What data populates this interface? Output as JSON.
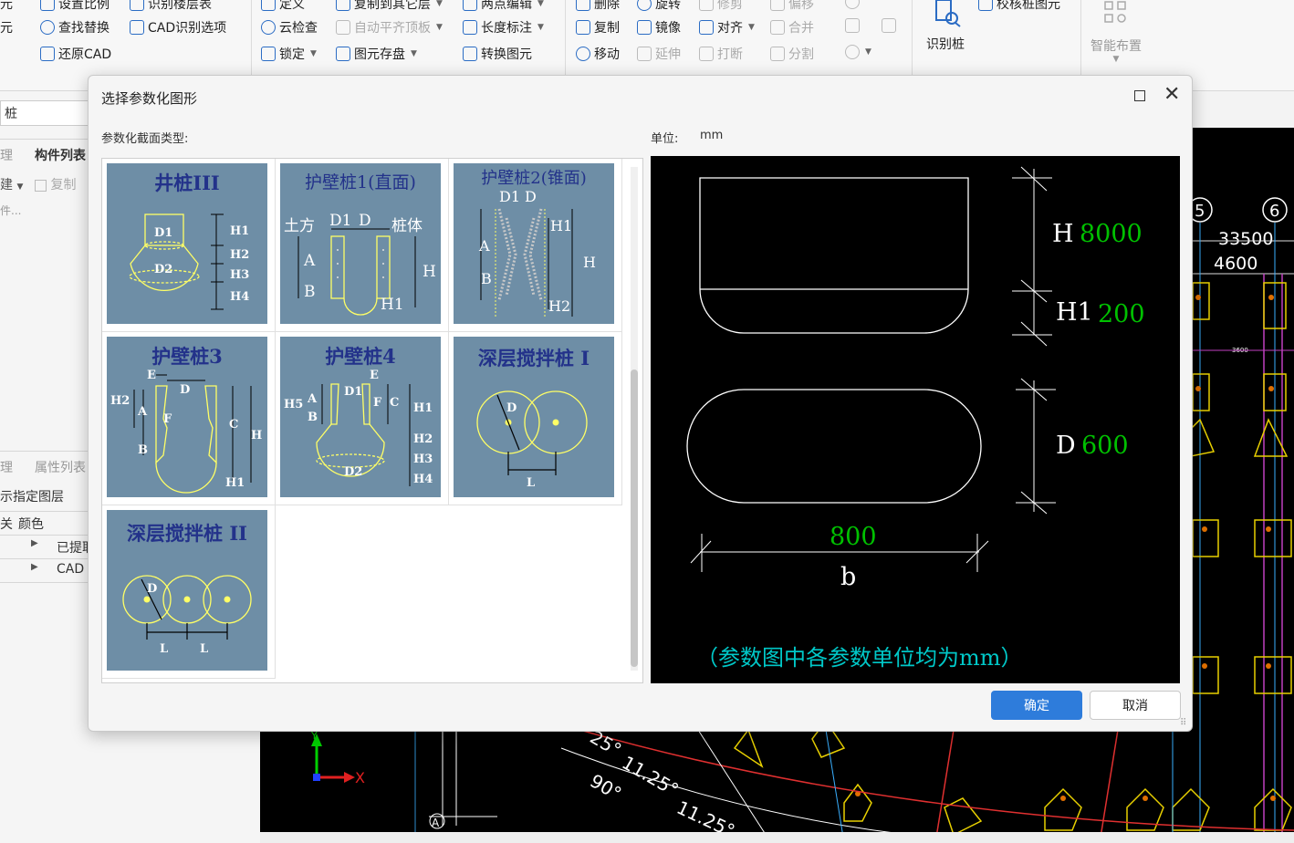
{
  "ribbon": {
    "set_scale": "设置比例",
    "identify_floor_table": "识别楼层表",
    "find_replace": "查找替换",
    "cad_options": "CAD识别选项",
    "restore_cad": "还原CAD",
    "define": "定义",
    "copy_to_other_floor": "复制到其它层",
    "two_point_edit": "两点编辑",
    "cloud_check": "云检查",
    "auto_level_top": "自动平齐顶板",
    "length_mark": "长度标注",
    "lock": "锁定",
    "element_save": "图元存盘",
    "convert_element": "转换图元",
    "delete": "删除",
    "rotate": "旋转",
    "trim": "修剪",
    "offset": "偏移",
    "copy": "复制",
    "mirror": "镜像",
    "align": "对齐",
    "merge": "合并",
    "move": "移动",
    "extend": "延伸",
    "break": "打断",
    "split": "分割",
    "identify_pile": "识别桩",
    "check_pile_element": "校核桩图元",
    "smart_layout": "智能布置",
    "left_cut_1": "元",
    "left_cut_2": "元"
  },
  "left_panel": {
    "search_value": "桩",
    "tab_manage": "理",
    "tab_component_list": "构件列表",
    "new": "建",
    "copy": "复制",
    "search_placeholder": "件...",
    "tab_manage2": "理",
    "tab_property_list": "属性列表",
    "show_layer": "示指定图层",
    "col_visible": "关",
    "col_color": "颜色",
    "row1": "已提取",
    "row2": "CAD"
  },
  "cad_texts": {
    "axis5": "5",
    "axis6": "6",
    "dim_33500": "33500",
    "dim_4600": "4600",
    "dim_3600": "3600",
    "angle1": "90°",
    "angle2": "11.25°",
    "angle3": "11.25°",
    "angle4": "25°",
    "bottom_axis": "A",
    "x_label": "X",
    "y_label": "Y"
  },
  "dialog": {
    "title": "选择参数化图形",
    "section_label": "参数化截面类型:",
    "unit_label": "单位:",
    "unit_value": "mm",
    "ok": "确定",
    "cancel": "取消",
    "items": [
      {
        "title": "井桩III",
        "labels": [
          "D1",
          "D2",
          "H1",
          "H2",
          "H3",
          "H4"
        ]
      },
      {
        "title": "护壁桩1(直面)",
        "labels": [
          "土方",
          "D1",
          "D",
          "桩体",
          "A",
          "B",
          "H",
          "H1"
        ]
      },
      {
        "title": "护壁桩2(锥面)",
        "labels": [
          "D1",
          "D",
          "A",
          "B",
          "H1",
          "H",
          "H2"
        ]
      },
      {
        "title": "护壁桩3",
        "labels": [
          "E",
          "D",
          "H2",
          "A",
          "F",
          "C",
          "H",
          "B",
          "H1"
        ]
      },
      {
        "title": "护壁桩4",
        "labels": [
          "E",
          "D1",
          "H5",
          "A",
          "B",
          "F",
          "C",
          "H1",
          "H2",
          "H3",
          "H4",
          "D2"
        ]
      },
      {
        "title": "深层搅拌桩 I",
        "labels": [
          "D",
          "L"
        ]
      },
      {
        "title": "深层搅拌桩 II",
        "labels": [
          "D",
          "L",
          "L"
        ]
      }
    ],
    "preview": {
      "h_label": "H",
      "h_value": "8000",
      "h1_label": "H1",
      "h1_value": "200",
      "d_label": "D",
      "d_value": "600",
      "b_value": "800",
      "b_label": "b",
      "note": "（参数图中各参数单位均为mm）"
    }
  },
  "colors": {
    "accent": "#2e7cdb",
    "thumb_bg": "#6e8ea6",
    "thumb_title": "#23328a",
    "preview_green": "#00c000",
    "preview_cyan": "#00c8c8"
  }
}
